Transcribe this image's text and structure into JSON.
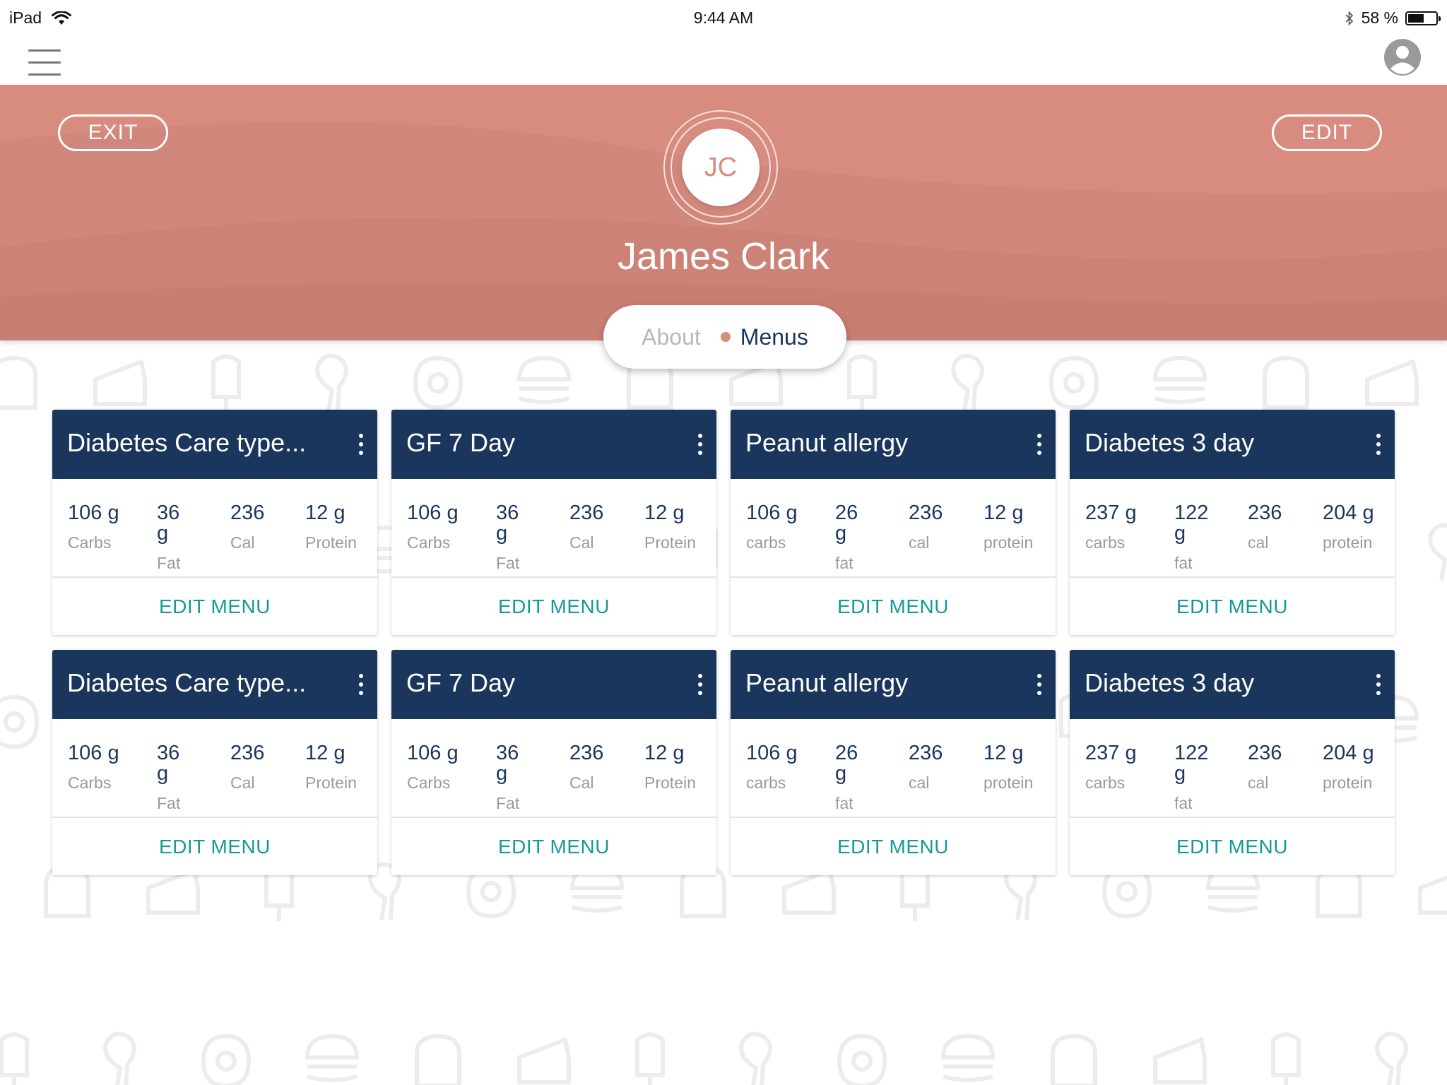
{
  "status_bar": {
    "device": "iPad",
    "time": "9:44 AM",
    "battery_text": "58 %",
    "battery_level": 0.58
  },
  "navbar": {
    "menu_icon": "hamburger-icon",
    "profile_icon": "user-circle-icon"
  },
  "header": {
    "exit_label": "EXIT",
    "edit_label": "EDIT",
    "initials": "JC",
    "name": "James Clark",
    "tabs": [
      {
        "label": "About"
      },
      {
        "label": "Menus"
      }
    ]
  },
  "colors": {
    "header_bg": "#d88c80",
    "card_header": "#1b365d",
    "accent_teal": "#17999a"
  },
  "cards": [
    {
      "title": "Diabetes Care type...",
      "stats": [
        {
          "v": "106 g",
          "l": "Carbs"
        },
        {
          "v": "36 g",
          "l": "Fat"
        },
        {
          "v": "236",
          "l": "Cal"
        },
        {
          "v": "12 g",
          "l": "Protein"
        }
      ],
      "action": "EDIT MENU"
    },
    {
      "title": "GF 7 Day",
      "stats": [
        {
          "v": "106 g",
          "l": "Carbs"
        },
        {
          "v": "36 g",
          "l": "Fat"
        },
        {
          "v": "236",
          "l": "Cal"
        },
        {
          "v": "12 g",
          "l": "Protein"
        }
      ],
      "action": "EDIT MENU"
    },
    {
      "title": "Peanut allergy",
      "stats": [
        {
          "v": "106 g",
          "l": "carbs"
        },
        {
          "v": "26 g",
          "l": "fat"
        },
        {
          "v": "236",
          "l": "cal"
        },
        {
          "v": "12 g",
          "l": "protein"
        }
      ],
      "action": "EDIT MENU"
    },
    {
      "title": "Diabetes 3 day",
      "stats": [
        {
          "v": "237 g",
          "l": "carbs"
        },
        {
          "v": "122 g",
          "l": "fat"
        },
        {
          "v": "236",
          "l": "cal"
        },
        {
          "v": "204 g",
          "l": "protein"
        }
      ],
      "action": "EDIT MENU"
    },
    {
      "title": "Diabetes Care type...",
      "stats": [
        {
          "v": "106 g",
          "l": "Carbs"
        },
        {
          "v": "36 g",
          "l": "Fat"
        },
        {
          "v": "236",
          "l": "Cal"
        },
        {
          "v": "12 g",
          "l": "Protein"
        }
      ],
      "action": "EDIT MENU"
    },
    {
      "title": "GF 7 Day",
      "stats": [
        {
          "v": "106 g",
          "l": "Carbs"
        },
        {
          "v": "36 g",
          "l": "Fat"
        },
        {
          "v": "236",
          "l": "Cal"
        },
        {
          "v": "12 g",
          "l": "Protein"
        }
      ],
      "action": "EDIT MENU"
    },
    {
      "title": "Peanut allergy",
      "stats": [
        {
          "v": "106 g",
          "l": "carbs"
        },
        {
          "v": "26 g",
          "l": "fat"
        },
        {
          "v": "236",
          "l": "cal"
        },
        {
          "v": "12 g",
          "l": "protein"
        }
      ],
      "action": "EDIT MENU"
    },
    {
      "title": "Diabetes 3 day",
      "stats": [
        {
          "v": "237 g",
          "l": "carbs"
        },
        {
          "v": "122 g",
          "l": "fat"
        },
        {
          "v": "236",
          "l": "cal"
        },
        {
          "v": "204 g",
          "l": "protein"
        }
      ],
      "action": "EDIT MENU"
    }
  ]
}
